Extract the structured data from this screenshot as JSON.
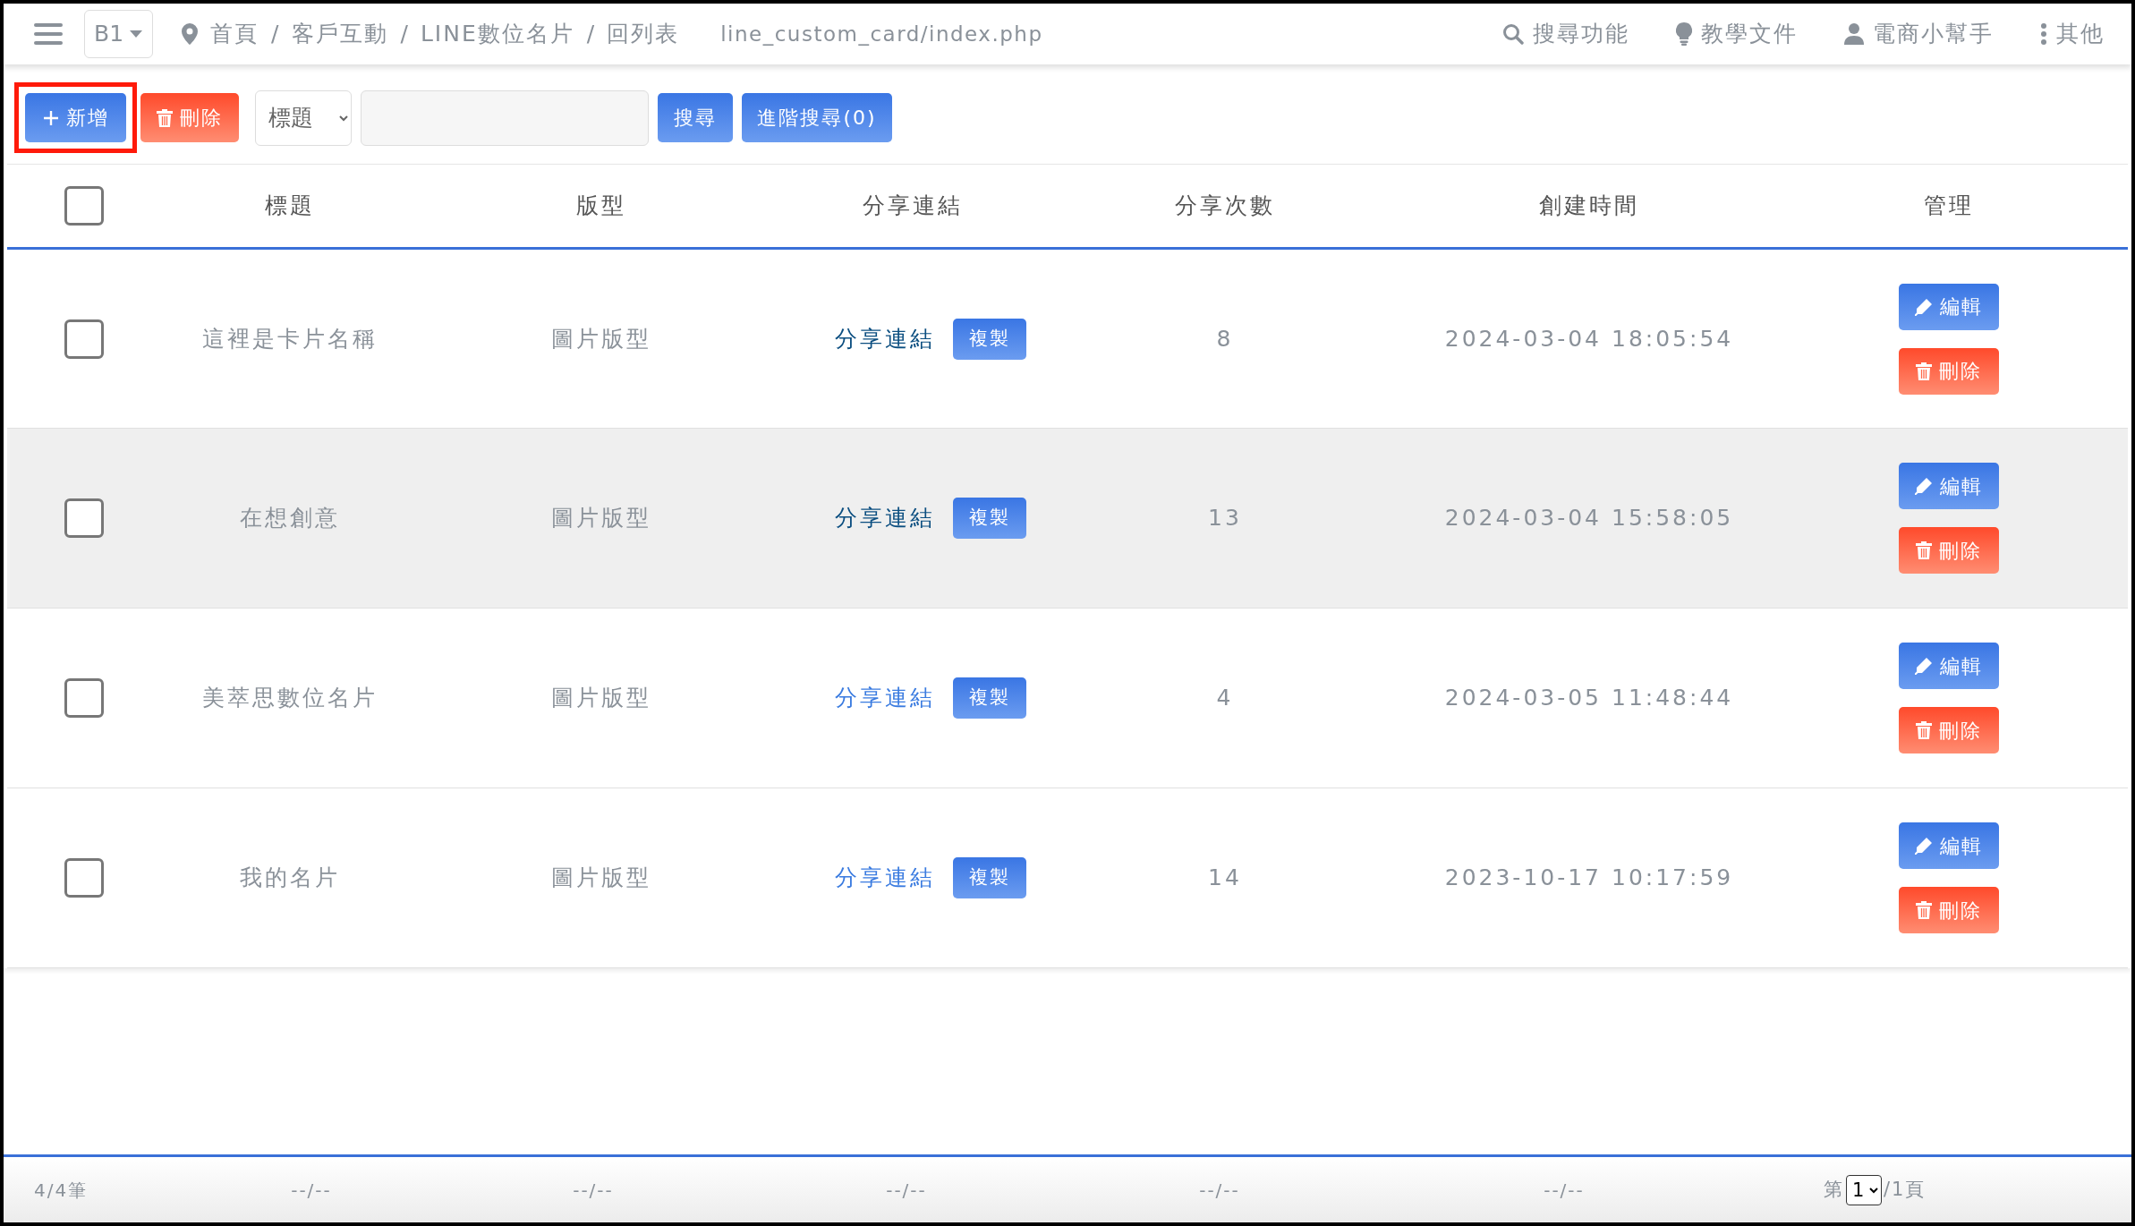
{
  "topbar": {
    "branch": "B1",
    "breadcrumbs": [
      "首頁",
      "客戶互動",
      "LINE數位名片",
      "回列表"
    ],
    "separator": "/",
    "path": "line_custom_card/index.php",
    "menu": [
      {
        "kind": "search",
        "label": "搜尋功能"
      },
      {
        "kind": "docs",
        "label": "教學文件"
      },
      {
        "kind": "helper",
        "label": "電商小幫手"
      },
      {
        "kind": "more",
        "label": "其他"
      }
    ]
  },
  "toolbar": {
    "add_label": "新增",
    "add_highlighted": true,
    "delete_label": "刪除",
    "filter_select": "標題",
    "search_label": "搜尋",
    "advanced_label": "進階搜尋(0)"
  },
  "table": {
    "columns": [
      "標題",
      "版型",
      "分享連結",
      "分享次數",
      "創建時間",
      "管理"
    ],
    "select_all_checked": false,
    "rows": [
      {
        "checked": false,
        "highlighted": false,
        "title": "這裡是卡片名稱",
        "template": "圖片版型",
        "link": "分享連結",
        "link_visited": true,
        "copy": "複製",
        "count": "8",
        "created": "2024-03-04 18:05:54",
        "edit": "編輯",
        "delete": "刪除"
      },
      {
        "checked": false,
        "highlighted": true,
        "title": "在想創意",
        "template": "圖片版型",
        "link": "分享連結",
        "link_visited": true,
        "copy": "複製",
        "count": "13",
        "created": "2024-03-04 15:58:05",
        "edit": "編輯",
        "delete": "刪除"
      },
      {
        "checked": false,
        "highlighted": false,
        "title": "美萃思數位名片",
        "template": "圖片版型",
        "link": "分享連結",
        "link_visited": false,
        "copy": "複製",
        "count": "4",
        "created": "2024-03-05 11:48:44",
        "edit": "編輯",
        "delete": "刪除"
      },
      {
        "checked": false,
        "highlighted": false,
        "title": "我的名片",
        "template": "圖片版型",
        "link": "分享連結",
        "link_visited": false,
        "copy": "複製",
        "count": "14",
        "created": "2023-10-17 10:17:59",
        "edit": "編輯",
        "delete": "刪除"
      }
    ]
  },
  "footer": {
    "count": "4/4筆",
    "placeholders": [
      "--/--",
      "--/--",
      "--/--",
      "--/--",
      "--/--"
    ],
    "page_prefix": "第",
    "page": "1",
    "page_suffix": "/1頁"
  }
}
